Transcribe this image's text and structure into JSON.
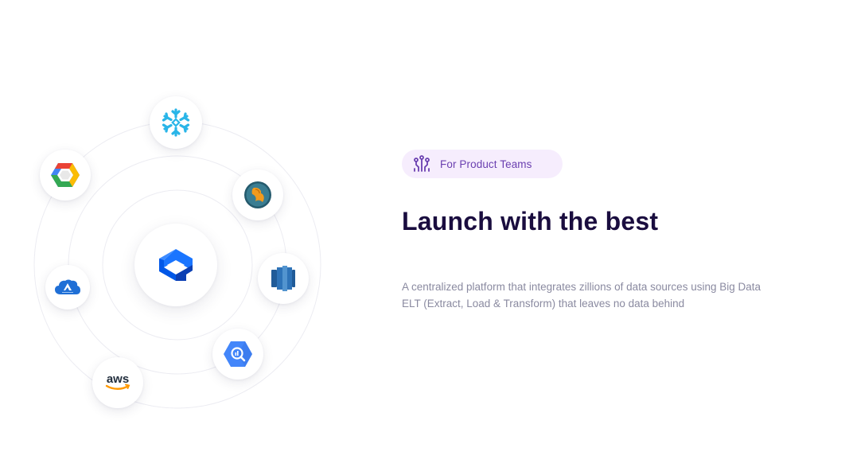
{
  "badge": {
    "label": "For Product Teams",
    "icon": "team-nodes-icon"
  },
  "headline": "Launch with the best",
  "description": "A centralized platform that integrates zillions of data sources using Big Data ELT (Extract, Load & Transform) that leaves no data behind",
  "hub": {
    "icon": "platform-logo-icon",
    "color": "#1a75ff"
  },
  "integrations": [
    {
      "name": "Snowflake",
      "icon": "snowflake-icon",
      "color": "#29b5e8"
    },
    {
      "name": "Google Cloud",
      "icon": "google-cloud-icon"
    },
    {
      "name": "MySQL",
      "icon": "mysql-icon",
      "color": "#00758f"
    },
    {
      "name": "Amazon Redshift",
      "icon": "redshift-icon",
      "color": "#205b98"
    },
    {
      "name": "Azure",
      "icon": "azure-cloud-icon",
      "color": "#1f6fd6"
    },
    {
      "name": "BigQuery",
      "icon": "bigquery-icon",
      "color": "#4386fa"
    },
    {
      "name": "AWS",
      "icon": "aws-icon",
      "label": "aws",
      "color": "#ff9900"
    }
  ],
  "colors": {
    "accent": "#6a3fb0",
    "badge_bg": "#f6edfd",
    "headline": "#1a0d3f",
    "body": "#8a8aa0"
  }
}
